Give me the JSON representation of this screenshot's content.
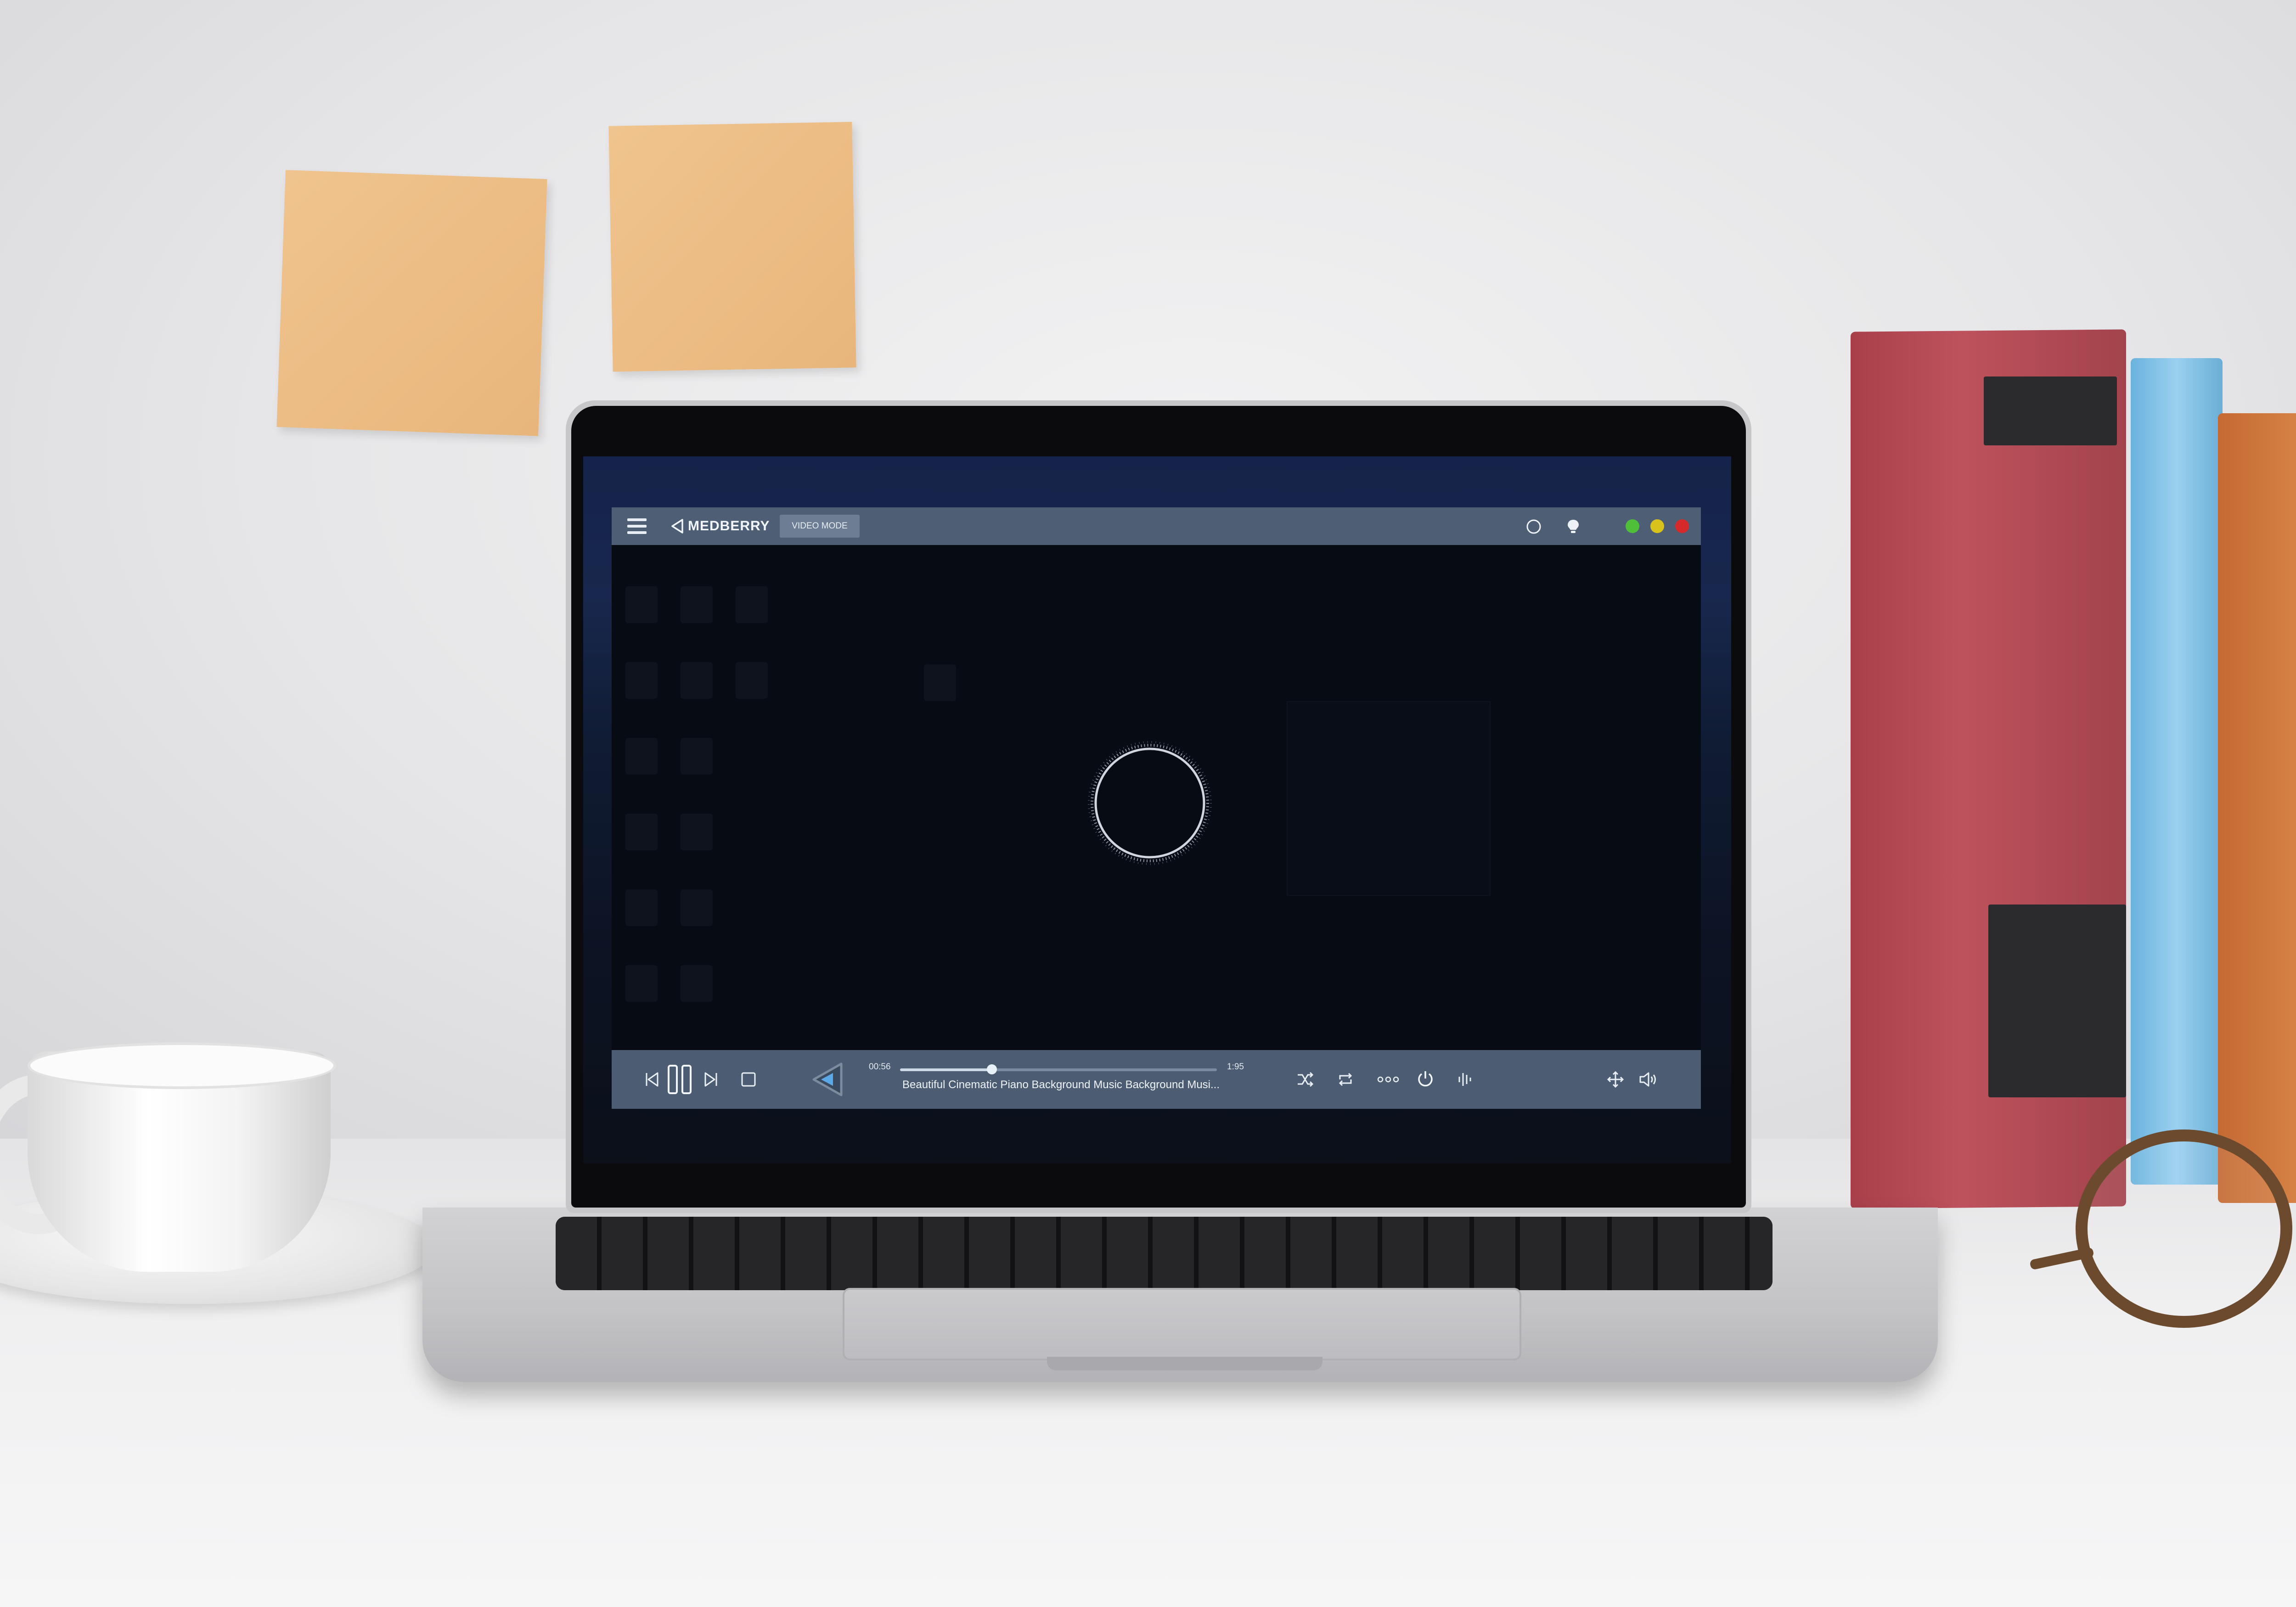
{
  "app": {
    "logo_text": "MEDBERRY",
    "mode_button": "VIDEO MODE",
    "window_buttons": {
      "minimize_color": "#4fbf3a",
      "maximize_color": "#d9c21c",
      "close_color": "#d62a2a"
    },
    "titlebar_icons": [
      "circle-icon",
      "lightbulb-icon"
    ]
  },
  "player": {
    "elapsed": "00:56",
    "duration": "1:95",
    "progress": 0.29,
    "track_title": "Beautiful Cinematic Piano Background Music Background Musi...",
    "controls": [
      "previous-icon",
      "pause-icon",
      "next-icon",
      "stop-icon",
      "play-toggle-icon",
      "shuffle-icon",
      "repeat-icon",
      "more-icon",
      "power-icon",
      "equalizer-icon",
      "move-icon",
      "volume-icon"
    ]
  },
  "colors": {
    "titlebar": "#4e5f75",
    "controlbar": "#4c5d73",
    "accent": "#5aa9e6",
    "video_background": "#070b14"
  }
}
